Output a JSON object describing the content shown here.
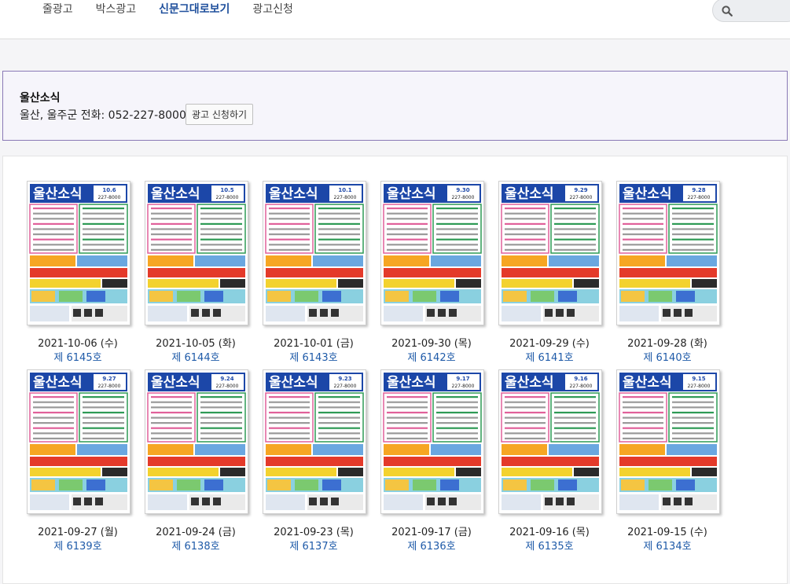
{
  "header": {
    "logo_fragment": "!",
    "nav": [
      {
        "label": "줄광고"
      },
      {
        "label": "박스광고"
      },
      {
        "label": "신문그대로보기",
        "active": true
      },
      {
        "label": "광고신청"
      }
    ],
    "search_icon": "search-icon"
  },
  "paper": {
    "name": "울산소식",
    "info": "울산, 울주군 전화: 052-227-8000",
    "apply_button": "광고 신청하기"
  },
  "thumbnail": {
    "masthead": "울산소식",
    "phone": "227-8000",
    "colors": {
      "masthead": "#1c47a8",
      "pink": "#e0609a",
      "green": "#2e9a55",
      "red": "#e43a2a",
      "yellow": "#f3d22e"
    }
  },
  "issues": [
    {
      "date": "2021-10-06 (수)",
      "number": "제 6145호",
      "badge": "10.6"
    },
    {
      "date": "2021-10-05 (화)",
      "number": "제 6144호",
      "badge": "10.5"
    },
    {
      "date": "2021-10-01 (금)",
      "number": "제 6143호",
      "badge": "10.1"
    },
    {
      "date": "2021-09-30 (목)",
      "number": "제 6142호",
      "badge": "9.30"
    },
    {
      "date": "2021-09-29 (수)",
      "number": "제 6141호",
      "badge": "9.29"
    },
    {
      "date": "2021-09-28 (화)",
      "number": "제 6140호",
      "badge": "9.28"
    },
    {
      "date": "2021-09-27 (월)",
      "number": "제 6139호",
      "badge": "9.27"
    },
    {
      "date": "2021-09-24 (금)",
      "number": "제 6138호",
      "badge": "9.24"
    },
    {
      "date": "2021-09-23 (목)",
      "number": "제 6137호",
      "badge": "9.23"
    },
    {
      "date": "2021-09-17 (금)",
      "number": "제 6136호",
      "badge": "9.17"
    },
    {
      "date": "2021-09-16 (목)",
      "number": "제 6135호",
      "badge": "9.16"
    },
    {
      "date": "2021-09-15 (수)",
      "number": "제 6134호",
      "badge": "9.15"
    }
  ]
}
